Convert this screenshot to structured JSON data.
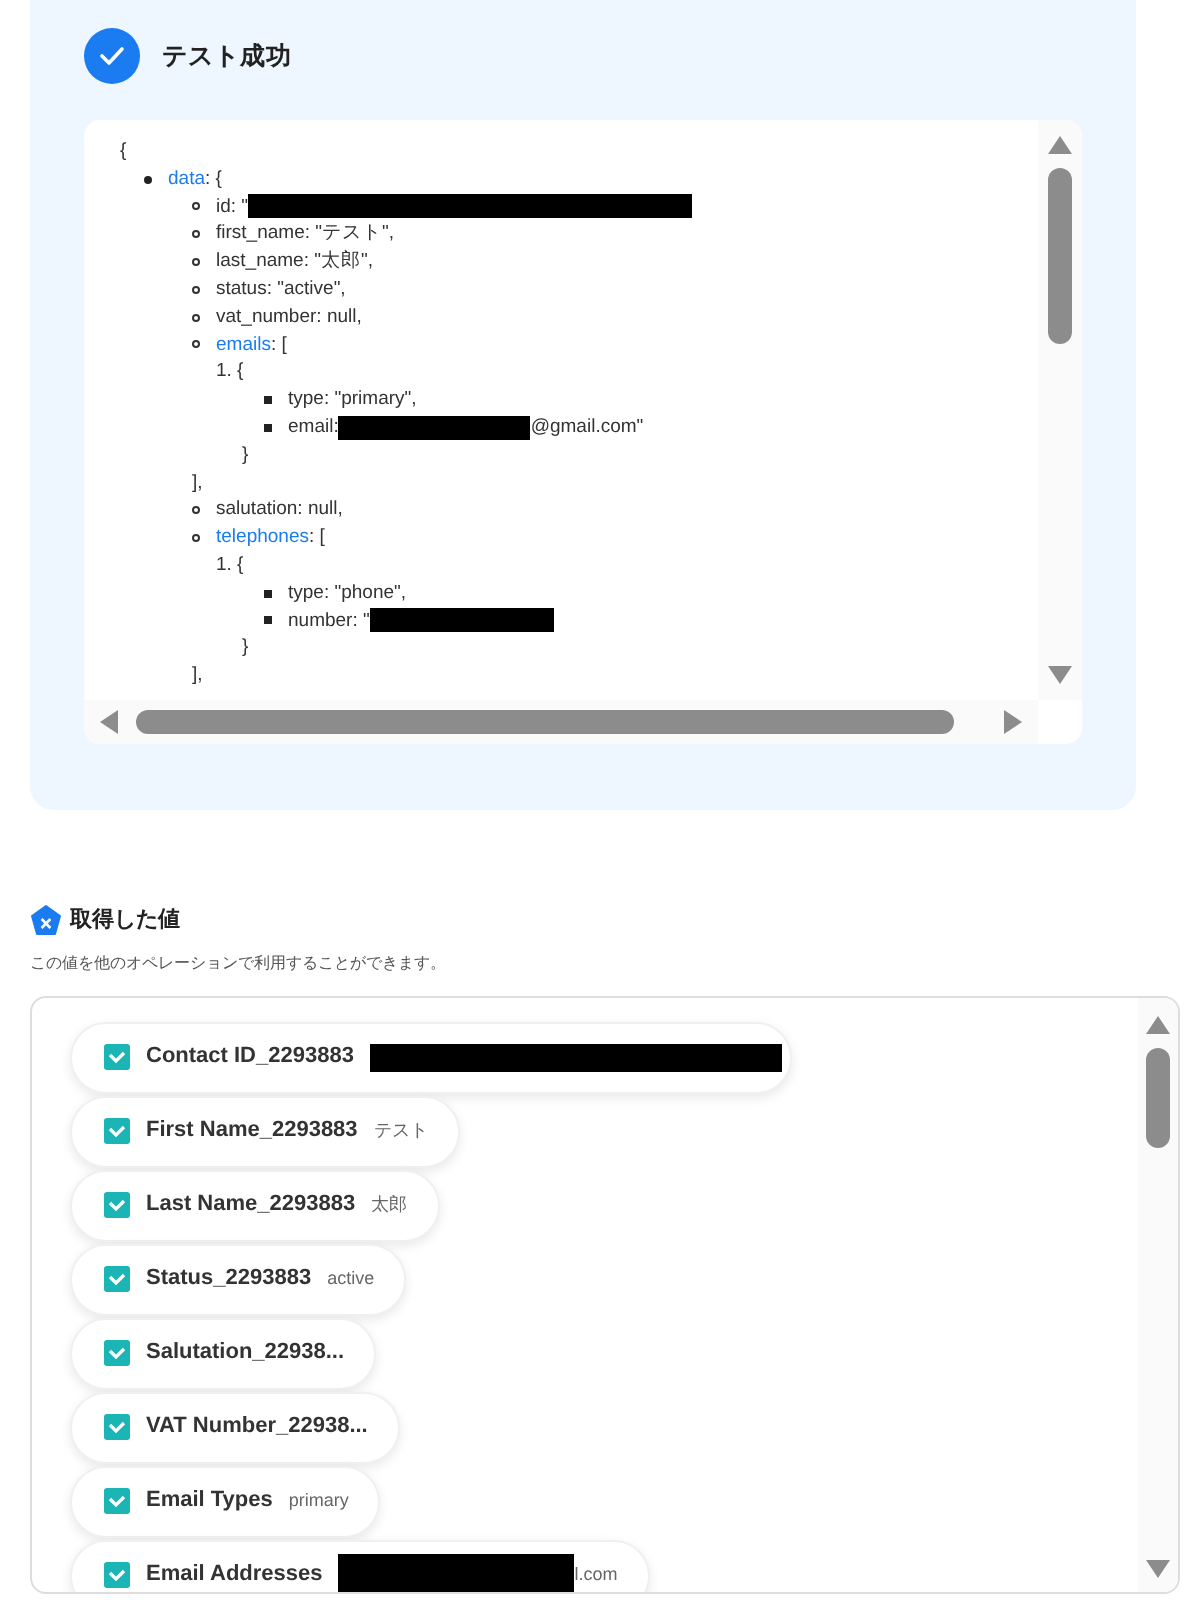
{
  "result": {
    "title": "テスト成功",
    "verified": true,
    "json_view": {
      "open": "{",
      "items": [
        {
          "key": "data",
          "linked": true,
          "open": ": {",
          "children": [
            {
              "text": "id: \"",
              "redacted": true
            },
            {
              "text": "first_name: \"テスト\","
            },
            {
              "text": "last_name: \"太郎\","
            },
            {
              "text": "status: \"active\","
            },
            {
              "text": "vat_number: null,"
            },
            {
              "key": "emails",
              "linked": true,
              "open": ": [",
              "entries": [
                {
                  "number": "1.",
                  "open": "{",
                  "children": [
                    {
                      "text": "type: \"primary\","
                    },
                    {
                      "text": "email: ",
                      "redacted": true,
                      "after": "@gmail.com\""
                    }
                  ],
                  "close": "}"
                }
              ],
              "close": "],"
            },
            {
              "text": "salutation: null,"
            },
            {
              "key": "telephones",
              "linked": true,
              "open": ": [",
              "entries": [
                {
                  "number": "1.",
                  "open": "{",
                  "children": [
                    {
                      "text": "type: \"phone\","
                    },
                    {
                      "text": "number: \"",
                      "redacted": true
                    }
                  ],
                  "close": "}"
                }
              ],
              "close": "],"
            }
          ]
        }
      ]
    }
  },
  "values": {
    "title": "取得した値",
    "description": "この値を他のオペレーションで利用することができます。",
    "items": [
      {
        "label": "Contact ID_2293883",
        "redacted": true
      },
      {
        "label": "First Name_2293883",
        "value": "テスト"
      },
      {
        "label": "Last Name_2293883",
        "value": "太郎"
      },
      {
        "label": "Status_2293883",
        "value": "active"
      },
      {
        "label": "Salutation_22938..."
      },
      {
        "label": "VAT Number_22938..."
      },
      {
        "label": "Email Types",
        "value": "primary"
      },
      {
        "label": "Email Addresses",
        "redacted": true,
        "value": "l.com"
      }
    ]
  }
}
